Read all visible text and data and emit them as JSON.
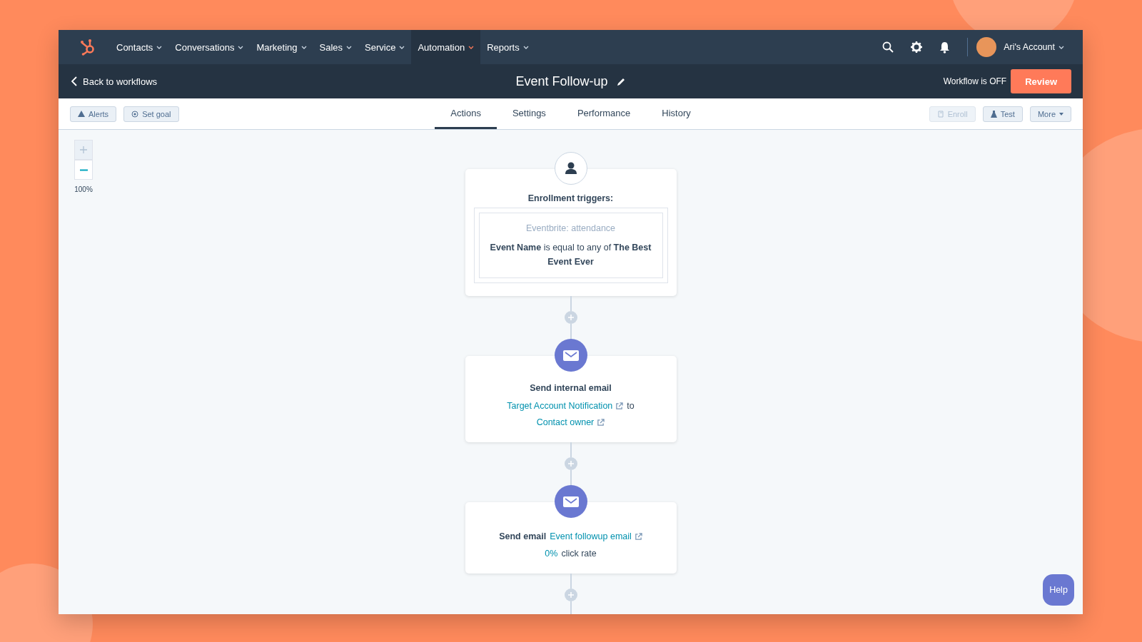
{
  "nav": {
    "items": [
      {
        "label": "Contacts",
        "selected": false
      },
      {
        "label": "Conversations",
        "selected": false
      },
      {
        "label": "Marketing",
        "selected": false
      },
      {
        "label": "Sales",
        "selected": false
      },
      {
        "label": "Service",
        "selected": false
      },
      {
        "label": "Automation",
        "selected": true
      },
      {
        "label": "Reports",
        "selected": false
      }
    ],
    "account": "Ari's Account"
  },
  "header": {
    "back": "Back to workflows",
    "title": "Event Follow-up",
    "status": "Workflow is OFF",
    "review": "Review"
  },
  "toolbar": {
    "left_buttons": [
      {
        "label": "Alerts",
        "kind": "alert",
        "disabled": false
      },
      {
        "label": "Set goal",
        "kind": "goal",
        "disabled": false
      }
    ],
    "tabs": [
      {
        "label": "Actions",
        "selected": true
      },
      {
        "label": "Settings",
        "selected": false
      },
      {
        "label": "Performance",
        "selected": false
      },
      {
        "label": "History",
        "selected": false
      }
    ],
    "right_buttons": [
      {
        "label": "Enroll",
        "kind": "enroll",
        "disabled": true
      },
      {
        "label": "Test",
        "kind": "test",
        "disabled": false
      },
      {
        "label": "More",
        "kind": "more",
        "disabled": false
      }
    ]
  },
  "zoom": {
    "zoom_in_disabled": true,
    "zoom_out_disabled": false,
    "level": "100%"
  },
  "nodes": [
    {
      "kind": "trigger",
      "title": "Enrollment triggers:",
      "source": "Eventbrite: attendance",
      "condition": "**Event Name** is equal to any of **The Best Event Ever**"
    },
    {
      "kind": "action",
      "title": "Send internal email",
      "lines": [
        [
          {
            "text": "Target Account Notification",
            "kind": "link"
          },
          {
            "text": "to",
            "kind": "plain"
          },
          {
            "text": "Contact owner",
            "kind": "link"
          }
        ]
      ]
    },
    {
      "kind": "action",
      "lines": [
        [
          {
            "text": "Send email",
            "kind": "bold"
          },
          {
            "text": "Event followup email",
            "kind": "link"
          }
        ],
        [
          {
            "text": "0%",
            "kind": "stat"
          },
          {
            "text": "click rate",
            "kind": "plain"
          }
        ]
      ]
    }
  ],
  "help": "Help"
}
